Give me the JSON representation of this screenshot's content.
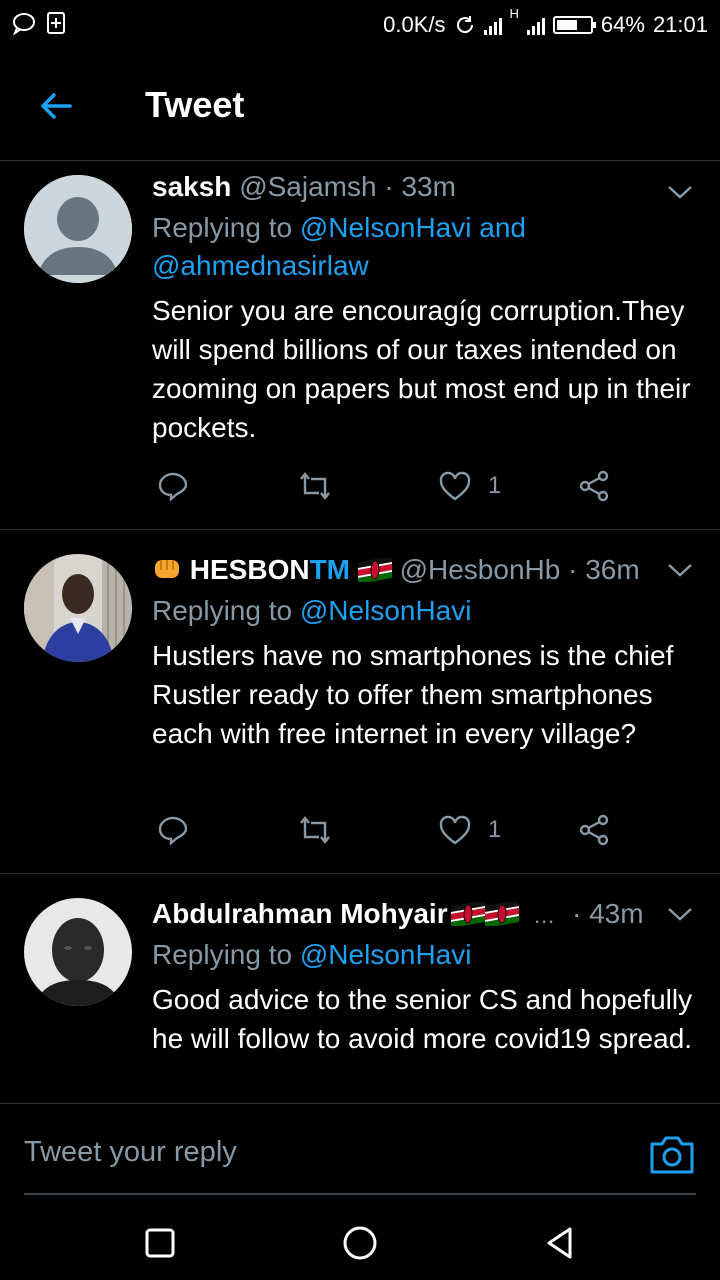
{
  "status_bar": {
    "speed": "0.0K/s",
    "network_type": "H",
    "battery": "64%",
    "battery_level": 0.64,
    "time": "21:01"
  },
  "header": {
    "title": "Tweet"
  },
  "tweets": [
    {
      "name": "saksh",
      "handle": "@Sajamsh",
      "time": "· 33m",
      "replying_prefix": "Replying to",
      "mentions": "@NelsonHavi and @ahmednasirlaw",
      "text": "Senior you are encouragíg corruption.They will spend billions of our taxes intended on zooming on papers but most end up in their pockets.",
      "likes": "1"
    },
    {
      "name": "HESBON",
      "name_suffix": "TM",
      "handle": "@HesbonHb",
      "time": "· 36m",
      "replying_prefix": "Replying to",
      "mentions": "@NelsonHavi",
      "text": "Hustlers have no smartphones is the chief Rustler ready to offer them smartphones each with free internet in every village?",
      "likes": "1"
    },
    {
      "name": "Abdulrahman Mohyair",
      "ellipsis": "…",
      "time": "· 43m",
      "replying_prefix": "Replying to",
      "mentions": "@NelsonHavi",
      "text": "Good advice to the senior CS and hopefully he will follow to avoid more covid19 spread."
    }
  ],
  "reply_bar": {
    "placeholder": "Tweet your reply"
  },
  "colors": {
    "accent": "#1da1f2",
    "muted": "#8899a6",
    "background": "#000000"
  }
}
